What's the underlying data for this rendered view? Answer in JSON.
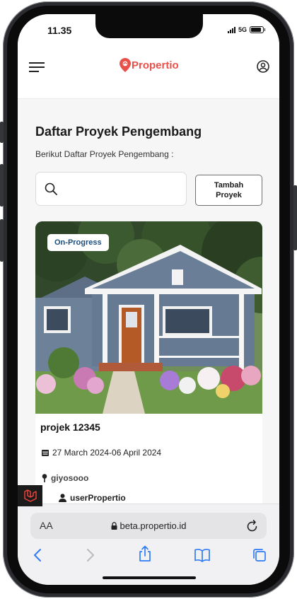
{
  "status_bar": {
    "time": "11.35",
    "network": "5G",
    "battery_percent": 90
  },
  "header": {
    "logo_text": "Propertio",
    "brand_color": "#e8514a"
  },
  "page": {
    "title": "Daftar Proyek Pengembang",
    "subtitle": "Berikut Daftar Proyek Pengembang :"
  },
  "search": {
    "value": "",
    "placeholder": ""
  },
  "add_button": {
    "label": "Tambah\nProyek"
  },
  "projects": [
    {
      "status": "On-Progress",
      "name": "projek 12345",
      "date_range": "27 March 2024-06 April 2024",
      "location": "giyosooo",
      "owner": "userPropertio"
    }
  ],
  "browser": {
    "text_size_label": "AA",
    "url": "beta.propertio.id"
  },
  "icons": {
    "menu": "hamburger-icon",
    "account": "user-circle-icon",
    "search": "search-icon",
    "calendar": "calendar-icon",
    "location": "pin-icon",
    "owner": "person-icon",
    "lock": "lock-icon",
    "reload": "reload-icon",
    "back": "chevron-left-icon",
    "forward": "chevron-right-icon",
    "share": "share-icon",
    "bookmarks": "book-icon",
    "tabs": "tabs-icon"
  },
  "colors": {
    "status_pill_text": "#1f4d7a",
    "safari_blue": "#2f7cf6",
    "laravel_red": "#f4443a"
  }
}
